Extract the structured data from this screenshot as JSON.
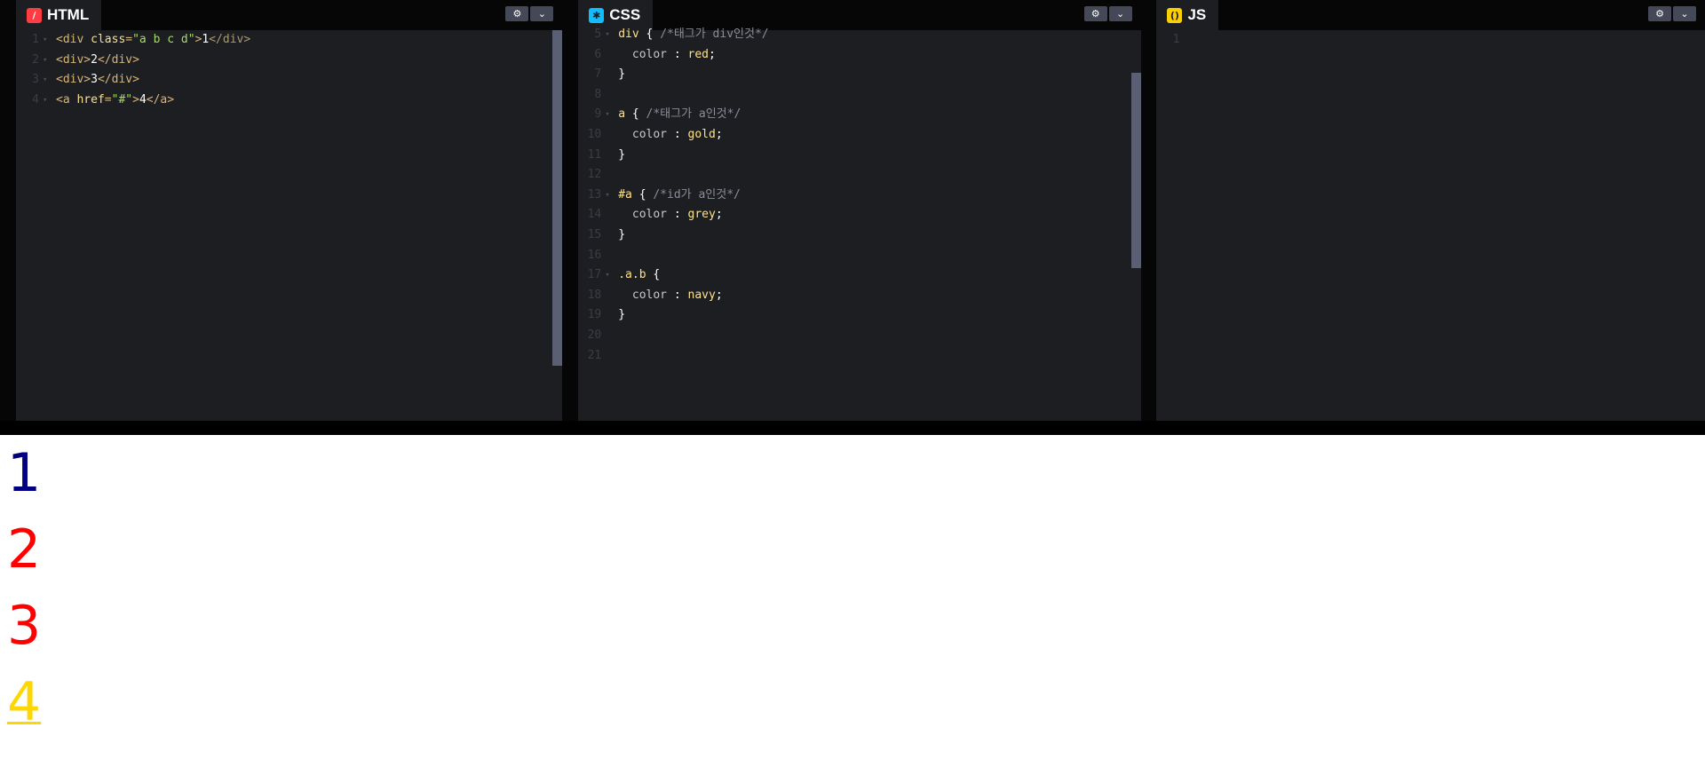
{
  "colors": {
    "panel_bg": "#1d1e22",
    "header_bg": "#060606",
    "html_icon": "#ff3c41",
    "css_icon": "#0ebeff",
    "js_icon": "#fcd000",
    "preview_navy": "#000080",
    "preview_red": "#ff0000",
    "preview_gold": "#ffd700"
  },
  "panes": {
    "html": {
      "title": "HTML",
      "icon": "html-slash-icon",
      "lines": [
        {
          "n": "1",
          "parts": [
            [
              "t-tag",
              "<div "
            ],
            [
              "t-attr",
              "class"
            ],
            [
              "t-tag",
              "="
            ],
            [
              "t-str",
              "\"a b c d\""
            ],
            [
              "t-tag",
              ">"
            ],
            [
              "t-txt",
              "1"
            ],
            [
              "t-close",
              "</div>"
            ]
          ]
        },
        {
          "n": "2",
          "parts": [
            [
              "t-tag",
              "<div>"
            ],
            [
              "t-txt",
              "2"
            ],
            [
              "t-tag",
              "</div>"
            ]
          ]
        },
        {
          "n": "3",
          "parts": [
            [
              "t-tag",
              "<div>"
            ],
            [
              "t-txt",
              "3"
            ],
            [
              "t-tag",
              "</div>"
            ]
          ]
        },
        {
          "n": "4",
          "parts": [
            [
              "t-tag",
              "<a "
            ],
            [
              "t-attr",
              "href"
            ],
            [
              "t-tag",
              "="
            ],
            [
              "t-str",
              "\"#\""
            ],
            [
              "t-tag",
              ">"
            ],
            [
              "t-txt",
              "4"
            ],
            [
              "t-tag",
              "</a>"
            ]
          ]
        }
      ]
    },
    "css": {
      "title": "CSS",
      "icon": "css-asterisk-icon",
      "lines": [
        {
          "n": "5",
          "fold": true,
          "parts": [
            [
              "t-sel",
              "div "
            ],
            [
              "t-txt",
              "{ "
            ],
            [
              "t-com",
              "/*태그가 div인것*/"
            ]
          ]
        },
        {
          "n": "6",
          "parts": [
            [
              "t-prop",
              "  color "
            ],
            [
              "t-txt",
              ": "
            ],
            [
              "t-val",
              "red"
            ],
            [
              "t-txt",
              ";"
            ]
          ]
        },
        {
          "n": "7",
          "parts": [
            [
              "t-txt",
              "}"
            ]
          ]
        },
        {
          "n": "8",
          "parts": []
        },
        {
          "n": "9",
          "fold": true,
          "parts": [
            [
              "t-sel",
              "a "
            ],
            [
              "t-txt",
              "{ "
            ],
            [
              "t-com",
              "/*태그가 a인것*/"
            ]
          ]
        },
        {
          "n": "10",
          "parts": [
            [
              "t-prop",
              "  color "
            ],
            [
              "t-txt",
              ": "
            ],
            [
              "t-val",
              "gold"
            ],
            [
              "t-txt",
              ";"
            ]
          ]
        },
        {
          "n": "11",
          "parts": [
            [
              "t-txt",
              "}"
            ]
          ]
        },
        {
          "n": "12",
          "parts": []
        },
        {
          "n": "13",
          "fold": true,
          "parts": [
            [
              "t-sel",
              "#a "
            ],
            [
              "t-txt",
              "{ "
            ],
            [
              "t-com",
              "/*id가 a인것*/"
            ]
          ]
        },
        {
          "n": "14",
          "parts": [
            [
              "t-prop",
              "  color "
            ],
            [
              "t-txt",
              ": "
            ],
            [
              "t-val",
              "grey"
            ],
            [
              "t-txt",
              ";"
            ]
          ]
        },
        {
          "n": "15",
          "parts": [
            [
              "t-txt",
              "}"
            ]
          ]
        },
        {
          "n": "16",
          "parts": []
        },
        {
          "n": "17",
          "fold": true,
          "parts": [
            [
              "t-sel",
              ".a.b "
            ],
            [
              "t-txt",
              "{"
            ]
          ]
        },
        {
          "n": "18",
          "parts": [
            [
              "t-prop",
              "  color "
            ],
            [
              "t-txt",
              ": "
            ],
            [
              "t-val",
              "navy"
            ],
            [
              "t-txt",
              ";"
            ]
          ]
        },
        {
          "n": "19",
          "parts": [
            [
              "t-txt",
              "}"
            ]
          ]
        },
        {
          "n": "20",
          "parts": []
        },
        {
          "n": "21",
          "parts": []
        }
      ]
    },
    "js": {
      "title": "JS",
      "icon": "js-braces-icon",
      "lines": [
        {
          "n": "1",
          "parts": []
        }
      ]
    }
  },
  "buttons": {
    "settings_icon": "⚙",
    "collapse_icon": "⌄"
  },
  "preview": {
    "items": [
      "1",
      "2",
      "3",
      "4"
    ]
  }
}
